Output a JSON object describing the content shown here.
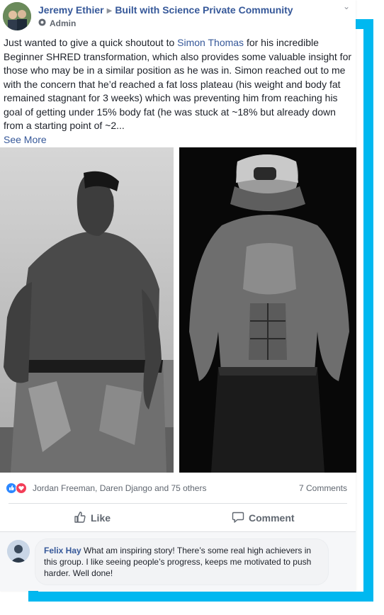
{
  "post": {
    "author": "Jeremy Ethier",
    "group": "Built with Science Private Community",
    "role": "Admin",
    "text_before_mention": "Just wanted to give a quick shoutout to ",
    "mention": "Simon Thomas",
    "text_after_mention": " for his incredible Beginner SHRED transformation, which also provides some valuable insight for those who may be in a similar position as he was in. Simon reached out to me with the concern that he’d reached a fat loss plateau (his weight and body fat remained stagnant for 3 weeks) which was preventing him from reaching his goal of getting under 15% body fat (he was stuck at ~18% but already down from a starting point of ~2...",
    "see_more": "See More"
  },
  "reactions": {
    "icons": [
      "like-icon",
      "love-icon"
    ],
    "names": "Jordan Freeman, Daren Django and 75 others",
    "comments": "7 Comments"
  },
  "actions": {
    "like": "Like",
    "comment": "Comment"
  },
  "comment": {
    "author": "Felix Hay",
    "text": " What am inspiring story! There’s some real high achievers in this group. I like seeing people’s progress, keeps me motivated to push harder. Well done!"
  },
  "colors": {
    "accent_frame": "#00b8f0",
    "link": "#365899",
    "like_blue": "#2d88ff",
    "love_red": "#f33e58"
  }
}
